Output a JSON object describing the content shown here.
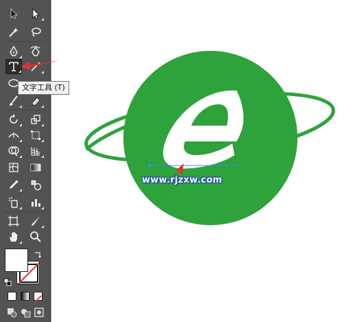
{
  "tooltip": {
    "text": "文字工具 (T)"
  },
  "watermark": {
    "text": "www.rjzxw.com"
  },
  "colors": {
    "panel": "#535353",
    "logo_green": "#2ea23b",
    "arrow_red": "#e5312f",
    "selection_blue": "#4a80ff"
  },
  "toolbar": {
    "tools": [
      {
        "name": "selection-tool",
        "icon": "arrow-icon"
      },
      {
        "name": "direct-selection-tool",
        "icon": "hollow-arrow-icon"
      },
      {
        "name": "magic-wand-tool",
        "icon": "magic-wand-icon"
      },
      {
        "name": "lasso-tool",
        "icon": "lasso-icon"
      },
      {
        "name": "pen-tool",
        "icon": "pen-icon"
      },
      {
        "name": "curvature-tool",
        "icon": "curvature-pen-icon"
      },
      {
        "name": "type-tool",
        "icon": "type-icon",
        "active": true
      },
      {
        "name": "line-tool",
        "icon": "line-icon"
      },
      {
        "name": "ellipse-tool",
        "icon": "ellipse-icon"
      },
      {
        "name": "paintbrush-tool",
        "icon": "brush-icon"
      },
      {
        "name": "eraser-tool",
        "icon": "eraser-icon"
      },
      {
        "name": "rotate-tool",
        "icon": "rotate-icon"
      },
      {
        "name": "scale-tool",
        "icon": "scale-icon"
      },
      {
        "name": "width-tool",
        "icon": "width-icon"
      },
      {
        "name": "free-transform-tool",
        "icon": "free-transform-icon"
      },
      {
        "name": "shape-builder-tool",
        "icon": "shape-builder-icon"
      },
      {
        "name": "perspective-grid-tool",
        "icon": "perspective-icon"
      },
      {
        "name": "mesh-tool",
        "icon": "mesh-icon"
      },
      {
        "name": "gradient-tool",
        "icon": "gradient-icon"
      },
      {
        "name": "eyedropper-tool",
        "icon": "eyedropper-icon"
      },
      {
        "name": "blend-tool",
        "icon": "blend-icon"
      },
      {
        "name": "symbol-sprayer-tool",
        "icon": "symbol-sprayer-icon"
      },
      {
        "name": "column-graph-tool",
        "icon": "graph-icon"
      },
      {
        "name": "artboard-tool",
        "icon": "artboard-icon"
      },
      {
        "name": "slice-tool",
        "icon": "slice-icon"
      },
      {
        "name": "hand-tool",
        "icon": "hand-icon"
      },
      {
        "name": "zoom-tool",
        "icon": "zoom-icon"
      }
    ]
  }
}
